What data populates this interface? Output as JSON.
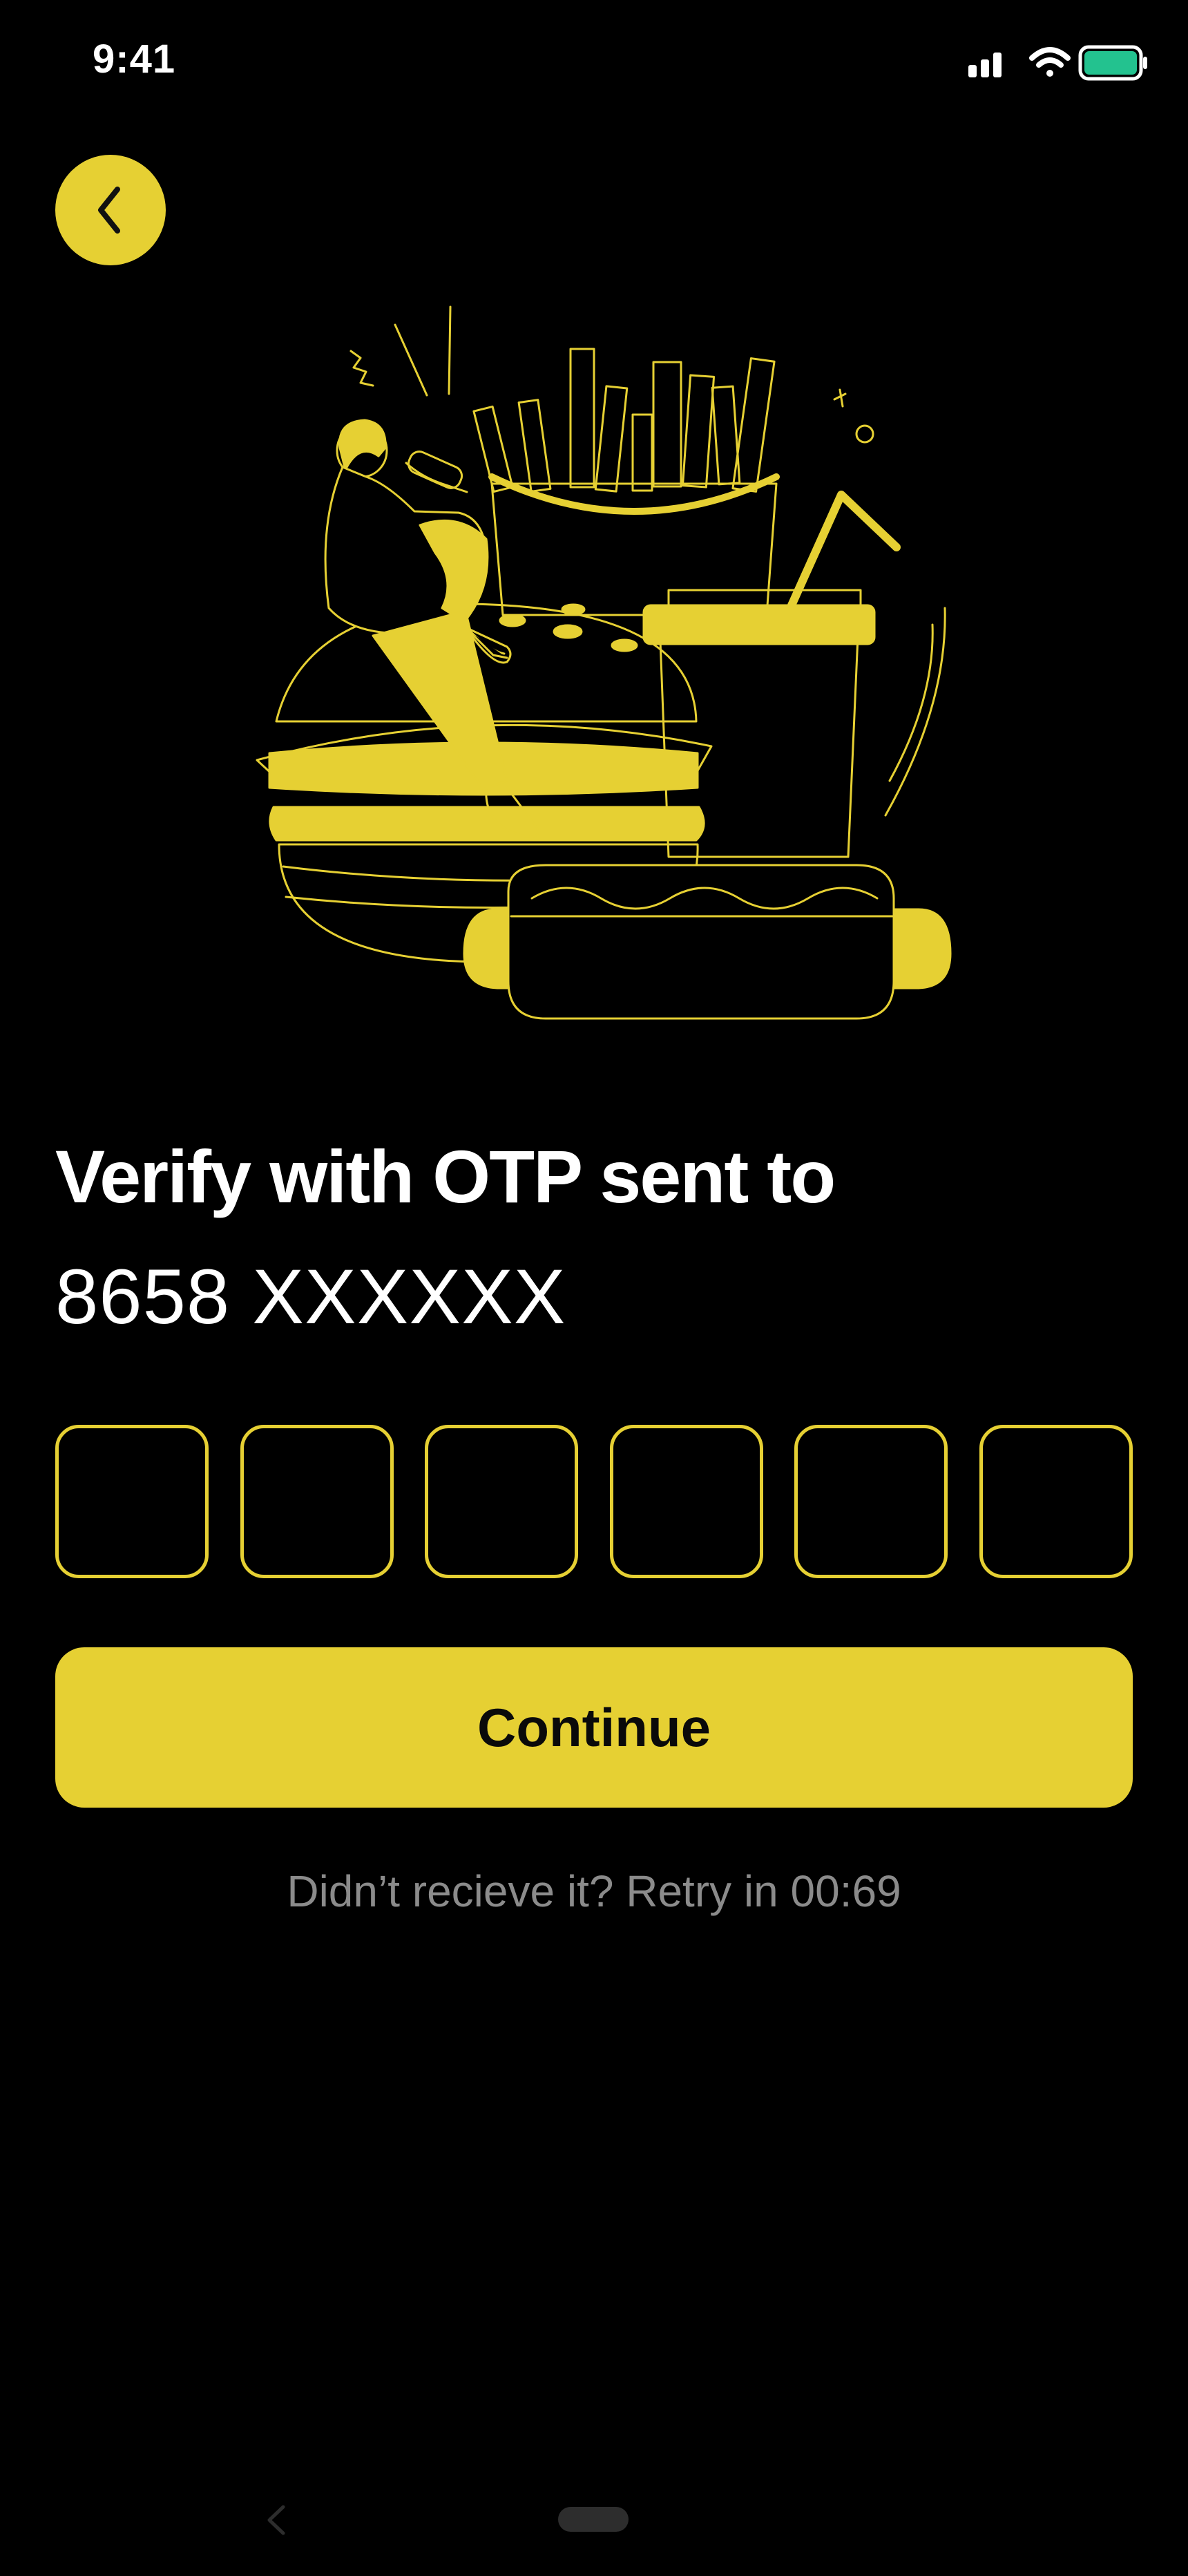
{
  "status_bar": {
    "time": "9:41",
    "icons": [
      "cellular-signal-icon",
      "wifi-icon",
      "battery-icon"
    ],
    "battery_color": "#23c28f"
  },
  "back_button": {
    "icon": "chevron-left-icon"
  },
  "illustration": {
    "icon": "fast-food-illustration"
  },
  "verify": {
    "heading": "Verify with OTP sent to",
    "phone": "8658 XXXXXX"
  },
  "otp": {
    "boxes": [
      "",
      "",
      "",
      "",
      "",
      ""
    ]
  },
  "continue_label": "Continue",
  "retry_text": "Didn’t recieve it? Retry in 00:69",
  "colors": {
    "background": "#000000",
    "accent": "#e6d033",
    "muted_text": "#8b8b8b"
  },
  "system_nav": {
    "icons": [
      "nav-back-icon",
      "home-indicator"
    ]
  }
}
